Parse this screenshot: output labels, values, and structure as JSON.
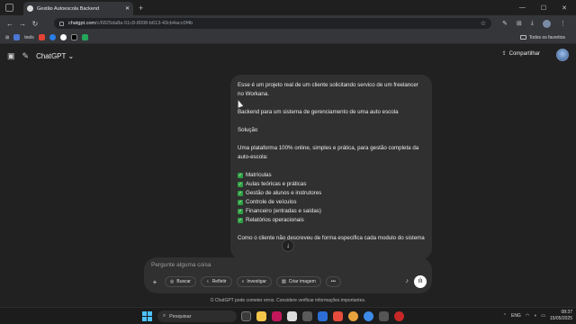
{
  "browser": {
    "tab_title": "Gestão Autoescola Backend",
    "url_host": "chatgpt.com",
    "url_path": "/c/6825da8a-51c8-8008-b613-43cb4acc0f4b",
    "bookmarks": [
      "tools"
    ],
    "bookmarks_folder": "Todos os favoritos"
  },
  "header": {
    "model_label": "ChatGPT",
    "share_label": "Compartilhar"
  },
  "message": {
    "intro": "Esse é um projeto real de um cliente solicitando servico de um freelancer no Workana.",
    "subtitle": "Backend para um sistema de gerenciamento de uma auto escola",
    "section": "Solução",
    "description": "Uma plataforma 100% online, simples e prática, para gestão completa da auto-escola:",
    "features": [
      "Matrículas",
      "Aulas teóricas e práticas",
      "Gestão de alunos e instrutores",
      "Controle de veículos",
      "Financeiro (entradas e saídas)",
      "Relatórios operacionais"
    ],
    "closing": "Como o cliente não descreveu de forma especifica cada modulo do sistema"
  },
  "composer": {
    "placeholder": "Pergunte alguma coisa",
    "tools": [
      "Buscar",
      "Refletir",
      "Investigar",
      "Criar imagem"
    ]
  },
  "disclaimer": "O ChatGPT pode cometer erros. Considere verificar informações importantes.",
  "taskbar": {
    "search_placeholder": "Pesquisar",
    "language": "ENG",
    "time": "08:37",
    "date": "15/05/2025"
  },
  "colors": {
    "background": "#212121",
    "bubble": "#303030",
    "check": "#2ea043",
    "windows_accent": "#4cc2ff"
  }
}
